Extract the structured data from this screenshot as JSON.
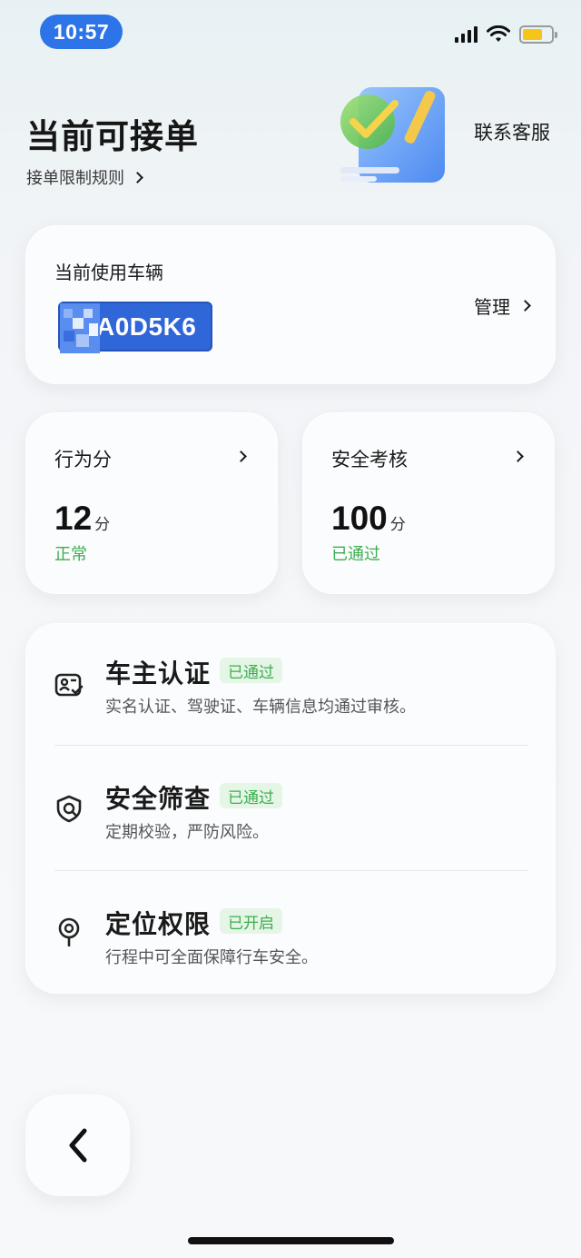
{
  "status_bar": {
    "time": "10:57"
  },
  "header": {
    "title": "当前可接单",
    "rules_link": "接单限制规则",
    "contact": "联系客服"
  },
  "vehicle": {
    "label": "当前使用车辆",
    "plate": "A0D5K6",
    "manage": "管理"
  },
  "scores": [
    {
      "title": "行为分",
      "value": "12",
      "unit": "分",
      "status": "正常"
    },
    {
      "title": "安全考核",
      "value": "100",
      "unit": "分",
      "status": "已通过"
    }
  ],
  "certifications": [
    {
      "icon": "id-card-check-icon",
      "title": "车主认证",
      "badge": "已通过",
      "desc": "实名认证、驾驶证、车辆信息均通过审核。"
    },
    {
      "icon": "shield-check-icon",
      "title": "安全筛查",
      "badge": "已通过",
      "desc": "定期校验，严防风险。"
    },
    {
      "icon": "location-pin-icon",
      "title": "定位权限",
      "badge": "已开启",
      "desc": "行程中可全面保障行车安全。"
    }
  ],
  "colors": {
    "accent_blue": "#2c74e8",
    "plate_blue": "#2f66d8",
    "status_green": "#3cae4f",
    "badge_bg": "#e5f5e6"
  },
  "navigation": {
    "back_icon": "chevron-left-icon"
  }
}
